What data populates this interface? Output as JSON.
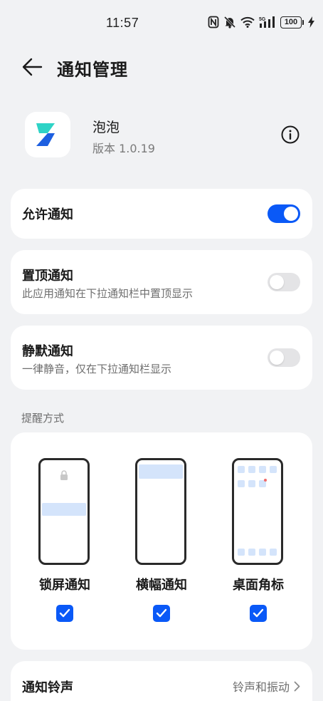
{
  "status_bar": {
    "time": "11:57",
    "battery": "100",
    "icons": [
      "nfc-icon",
      "mute-icon",
      "wifi-icon",
      "5g-signal-icon",
      "battery-icon",
      "charging-icon"
    ]
  },
  "header": {
    "title": "通知管理",
    "back_icon": "arrow-left-icon"
  },
  "app": {
    "name": "泡泡",
    "version": "版本 1.0.19",
    "info_icon": "info-icon"
  },
  "allow_notifications": {
    "title": "允许通知",
    "enabled": true
  },
  "pinned_notifications": {
    "title": "置顶通知",
    "subtitle": "此应用通知在下拉通知栏中置顶显示",
    "enabled": false
  },
  "silent_notifications": {
    "title": "静默通知",
    "subtitle": "一律静音，仅在下拉通知栏显示",
    "enabled": false
  },
  "reminder": {
    "section_label": "提醒方式",
    "options": [
      {
        "label": "锁屏通知",
        "checked": true
      },
      {
        "label": "横幅通知",
        "checked": true
      },
      {
        "label": "桌面角标",
        "checked": true
      }
    ]
  },
  "ringtone": {
    "title": "通知铃声",
    "value": "铃声和振动"
  },
  "colors": {
    "accent": "#0a59f7",
    "background": "#f1f2f4",
    "card": "#ffffff",
    "banner": "#d4e4fb"
  }
}
